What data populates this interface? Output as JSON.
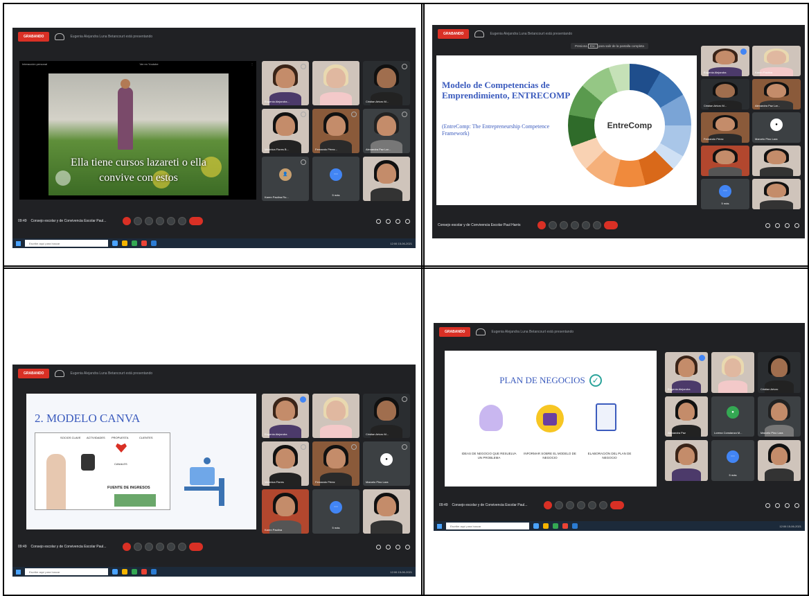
{
  "rec_label": "GRABANDO",
  "presenting_text": "Eugenia Alejandra Luna Betancourt está presentando",
  "fullscreen_hint": {
    "prefix": "Presiona",
    "key": "Esc",
    "suffix": "para salir de la pantalla completa"
  },
  "meeting_title": "Consejo escolar y de Convivencia Escolar Paul...",
  "meeting_title_full": "Consejo escolar y de Convivencia Escolar Paul Harris",
  "time": "09:49",
  "taskbar_search": "Escribe aquí para buscar",
  "clock": "12:06\n15-06-2021",
  "panel1": {
    "video_top_left": "Interacción personal",
    "video_top_mid": "Ver en Youtube",
    "subtitle_line1": "Ella tiene cursos lazareti o ella",
    "subtitle_line2": "convive con estos",
    "participants": [
      "Eugenia Alejandra...",
      "",
      "Cristian Arturo M...",
      "Verónica Flores B...",
      "Fernando Pérez...",
      "Alexandra Paz Lar...",
      "Karen Paulina Ro...",
      "",
      ""
    ],
    "extra_count": "5 más"
  },
  "panel2": {
    "slide_title": "Modelo de Competencias de Emprendimiento, ENTRECOMP",
    "slide_subtitle": "(EntreComp: The Entrepreneurship Competence Framework)",
    "wheel_center": "EntreComp",
    "participants": [
      "Eugenia Alejandra",
      "Karen Paulina",
      "Cristian Arturo M...",
      "Alexandra Paz Lar...",
      "Fernando Pérez",
      "Marcelo Pino Lara",
      "",
      "",
      "5 más",
      ""
    ]
  },
  "panel3": {
    "slide_title": "2. MODELO CANVA",
    "canvas_labels": [
      "SOCIOS CLAVE",
      "ACTIVIDADES",
      "PROPUESTA",
      "CLIENTES",
      "CANALES",
      "FUENTE DE INGRESOS"
    ],
    "participants": [
      "Eugenia Alejandra",
      "",
      "Cristian Arturo M...",
      "Verónica Flores",
      "Fernando Pérez",
      "Marcelo Pino Lara",
      "Karen Paulina",
      "5 más",
      ""
    ]
  },
  "panel4": {
    "slide_title": "PLAN DE NEGOCIOS",
    "items": [
      "IDEAS DE NEGOCIO QUE RESUELVA UN PROBLEMA",
      "INFORMAR SOBRE EL MODELO DE NEGOCIO",
      "ELABORACIÓN DEL PLAN DE NEGOCIO"
    ],
    "participants": [
      "Eugenia Alejandra",
      "",
      "Cristian Arturo",
      "Alexandra Paz",
      "Lorena Constanza M...",
      "Marcelo Pino Lara",
      "",
      "5 más",
      ""
    ]
  },
  "colors": {
    "meet_bg": "#202124",
    "record_red": "#d93025",
    "slide_blue": "#3b5bbd"
  }
}
